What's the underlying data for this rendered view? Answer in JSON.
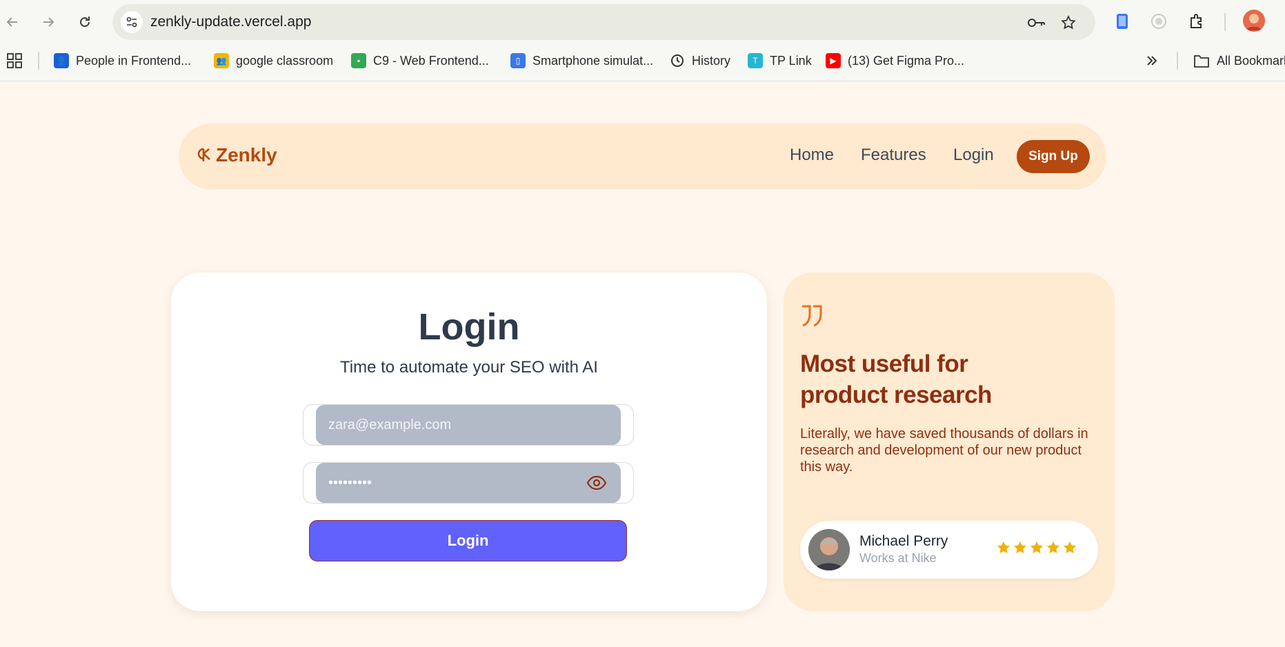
{
  "browser": {
    "url": "zenkly-update.vercel.app",
    "bookmarks": [
      {
        "label": "People in Frontend...",
        "icon": "contacts-icon",
        "color": "#1a5fd6"
      },
      {
        "label": "google classroom",
        "icon": "classroom-icon",
        "color": "#f4b400"
      },
      {
        "label": "C9 - Web Frontend...",
        "icon": "chat-icon",
        "color": "#34a853"
      },
      {
        "label": "Smartphone simulat...",
        "icon": "phone-icon",
        "color": "#3b78e7"
      },
      {
        "label": "History",
        "icon": "history-icon",
        "color": "#3c3c3c"
      },
      {
        "label": "TP Link",
        "icon": "tplink-icon",
        "color": "#26b6d2"
      },
      {
        "label": "(13) Get Figma Pro...",
        "icon": "youtube-icon",
        "color": "#ff0000"
      }
    ],
    "all_bookmarks": "All Bookmarks"
  },
  "site": {
    "brand": "Zenkly",
    "brand_color": "#b44a0d",
    "nav": {
      "home": "Home",
      "features": "Features",
      "login": "Login",
      "signup": "Sign Up"
    }
  },
  "login": {
    "title": "Login",
    "subtitle": "Time to automate your SEO with AI",
    "email_placeholder": "zara@example.com",
    "password_value": "•••••••••",
    "button": "Login",
    "button_color": "#6161fb"
  },
  "testimonial": {
    "heading_line1": "Most useful for",
    "heading_line2": "product research",
    "body": "Literally, we have saved thousands of dollars in research and development of our new product this way.",
    "author_name": "Michael Perry",
    "author_role": "Works at Nike",
    "rating": 5,
    "star_color": "#f0b10b"
  }
}
